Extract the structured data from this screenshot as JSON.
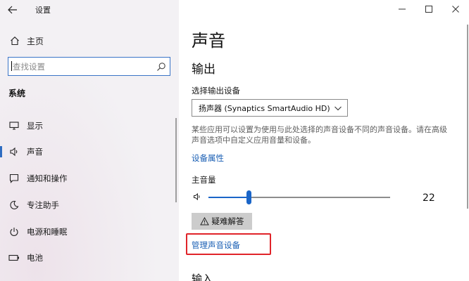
{
  "window": {
    "app_title": "设置",
    "controls": [
      {
        "name": "minimize",
        "icon": "minimize-icon"
      },
      {
        "name": "maximize",
        "icon": "maximize-icon"
      },
      {
        "name": "close",
        "icon": "close-icon"
      }
    ]
  },
  "sidebar": {
    "home_label": "主页",
    "search_placeholder": "查找设置",
    "section_title": "系统",
    "items": [
      {
        "label": "显示",
        "icon": "display-icon",
        "active": false
      },
      {
        "label": "声音",
        "icon": "sound-icon",
        "active": true
      },
      {
        "label": "通知和操作",
        "icon": "notification-icon",
        "active": false
      },
      {
        "label": "专注助手",
        "icon": "moon-icon",
        "active": false
      },
      {
        "label": "电源和睡眠",
        "icon": "power-icon",
        "active": false
      },
      {
        "label": "电池",
        "icon": "battery-icon",
        "active": false
      }
    ]
  },
  "main": {
    "page_title": "声音",
    "output_heading": "输出",
    "choose_device_label": "选择输出设备",
    "output_device_selected": "扬声器 (Synaptics SmartAudio HD)",
    "description": "某些应用可以设置为使用与此处选择的声音设备不同的声音设备。请在高级声音选项中自定义应用音量和设备。",
    "device_properties_link": "设备属性",
    "master_volume_label": "主音量",
    "volume": 22,
    "volume_max": 100,
    "troubleshoot_label": "疑难解答",
    "manage_devices_link": "管理声音设备",
    "input_heading": "输入"
  },
  "colors": {
    "accent": "#1a65c8",
    "link": "#1a5fb4",
    "highlight_box": "#e0242a"
  }
}
